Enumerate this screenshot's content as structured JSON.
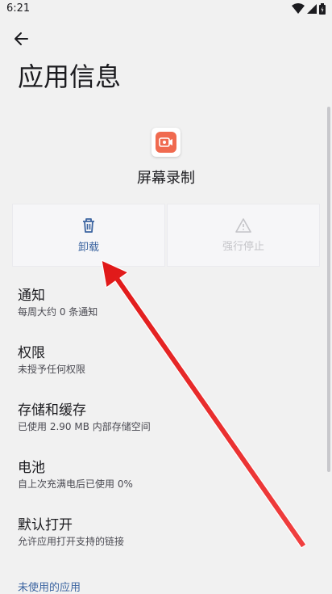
{
  "status_bar": {
    "time": "6:21"
  },
  "header": {
    "title": "应用信息"
  },
  "app": {
    "name": "屏幕录制"
  },
  "actions": {
    "uninstall": {
      "label": "卸载"
    },
    "force_stop": {
      "label": "强行停止"
    }
  },
  "settings": [
    {
      "title": "通知",
      "summary": "每周大约 0 条通知"
    },
    {
      "title": "权限",
      "summary": "未授予任何权限"
    },
    {
      "title": "存储和缓存",
      "summary": "已使用 2.90 MB 内部存储空间"
    },
    {
      "title": "电池",
      "summary": "自上次充满电后已使用 0%"
    },
    {
      "title": "默认打开",
      "summary": "允许应用打开支持的链接"
    }
  ],
  "unused_apps": {
    "header": "未使用的应用"
  },
  "colors": {
    "accent": "#3b64a0",
    "annotation": "#e82020",
    "app_icon": "#f06a4f"
  }
}
